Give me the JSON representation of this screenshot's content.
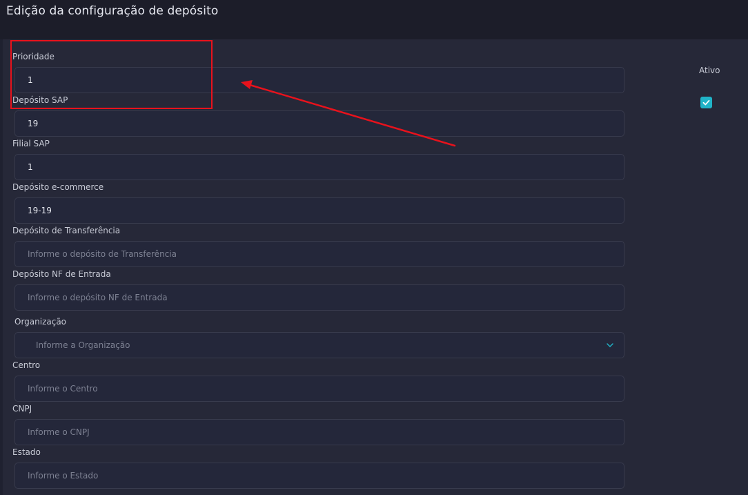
{
  "page": {
    "title": "Edição da configuração de depósito"
  },
  "form": {
    "prioridade": {
      "label": "Prioridade",
      "value": "1"
    },
    "deposito_sap": {
      "label": "Depósito SAP",
      "value": "19"
    },
    "filial_sap": {
      "label": "Filial SAP",
      "value": "1"
    },
    "deposito_ecommerce": {
      "label": "Depósito e-commerce",
      "value": "19-19"
    },
    "deposito_transferencia": {
      "label": "Depósito de Transferência",
      "placeholder": "Informe o depósito de Transferência"
    },
    "deposito_nf_entrada": {
      "label": "Depósito NF de Entrada",
      "placeholder": "Informe o depósito NF de Entrada"
    },
    "organizacao": {
      "label": "Organização",
      "placeholder": "Informe a Organização"
    },
    "centro": {
      "label": "Centro",
      "placeholder": "Informe o Centro"
    },
    "cnpj": {
      "label": "CNPJ",
      "placeholder": "Informe o CNPJ"
    },
    "estado": {
      "label": "Estado",
      "placeholder": "Informe o Estado"
    },
    "ativo": {
      "label": "Ativo",
      "checked": true
    }
  },
  "colors": {
    "accent": "#20b3c7",
    "annotation": "#e8121c",
    "background": "#262838",
    "header": "#1c1d29"
  },
  "icons": {
    "select": "chevron-down-icon",
    "checkbox": "check-icon"
  }
}
